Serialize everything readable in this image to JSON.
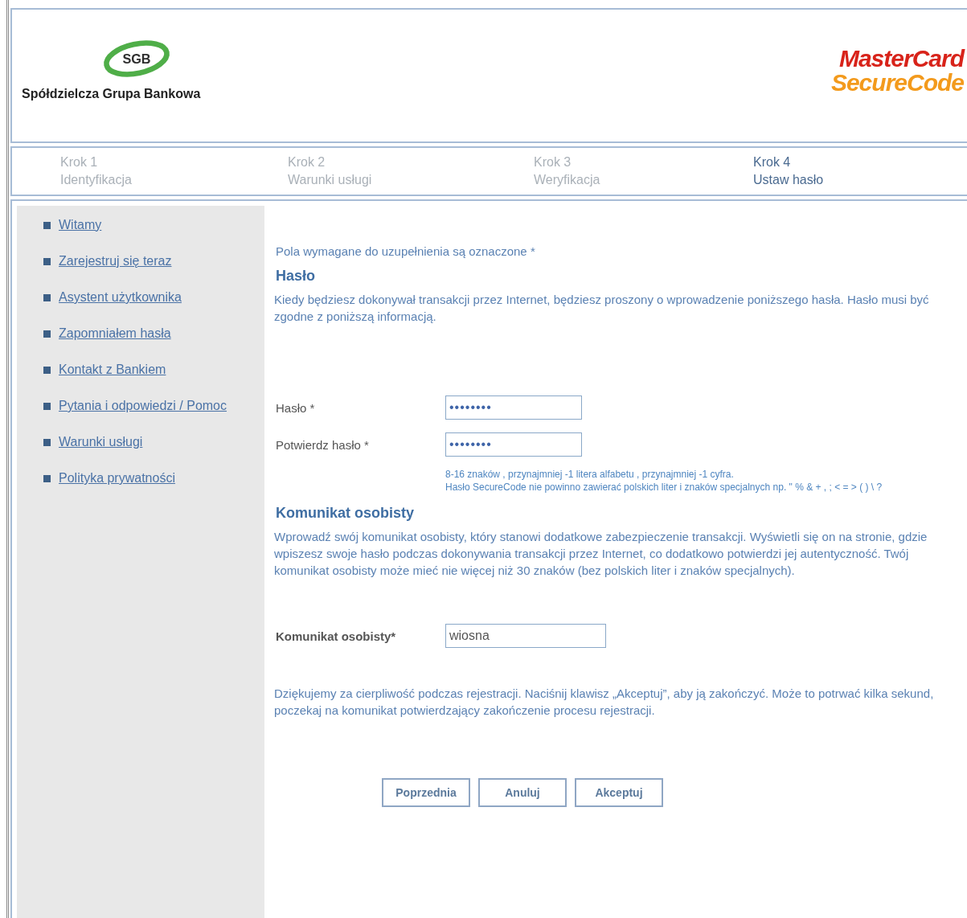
{
  "header": {
    "bank_logo": "SGB",
    "bank_name": "Spółdzielcza Grupa Bankowa",
    "brand_line_1": "MasterCard",
    "brand_line_2": "SecureCode"
  },
  "steps": [
    {
      "number": "Krok 1",
      "label": "Identyfikacja",
      "selected": false
    },
    {
      "number": "Krok 2",
      "label": "Warunki usługi",
      "selected": false
    },
    {
      "number": "Krok 3",
      "label": "Weryfikacja",
      "selected": false
    },
    {
      "number": "Krok 4",
      "label": "Ustaw hasło",
      "selected": true
    }
  ],
  "sidebar": {
    "items": [
      "Witamy",
      "Zarejestruj się teraz",
      "Asystent użytkownika",
      "Zapomniałem hasła",
      "Kontakt z Bankiem",
      "Pytania i odpowiedzi / Pomoc",
      "Warunki usługi",
      "Polityka prywatności"
    ]
  },
  "required_note": "Pola wymagane do uzupełnienia są oznaczone *",
  "password_section": {
    "title": "Hasło",
    "description": "Kiedy będziesz dokonywał transakcji przez Internet, będziesz proszony o wprowadzenie poniższego hasła. Hasło musi być zgodne z poniższą informacją.",
    "fields": [
      {
        "label": "Hasło *",
        "value": "••••••••"
      },
      {
        "label": "Potwierdz hasło *",
        "value": "••••••••"
      }
    ],
    "hints": [
      "8-16 znaków , przynajmniej -1 litera alfabetu , przynajmniej -1 cyfra.",
      "Hasło SecureCode nie powinno zawierać polskich liter i znaków specjalnych np. \" % & + , ; < = > ( ) \\ ?"
    ]
  },
  "message_section": {
    "title": "Komunikat osobisty",
    "description": "Wprowadź swój komunikat osobisty, który stanowi dodatkowe zabezpieczenie transakcji. Wyświetli się on na stronie, gdzie wpiszesz swoje hasło podczas dokonywania transakcji przez Internet, co dodatkowo potwierdzi jej autentyczność. Twój komunikat osobisty może mieć nie więcej niż 30 znaków (bez polskich liter i znaków specjalnych).",
    "field": {
      "label": "Komunikat osobisty*",
      "value": "wiosna"
    }
  },
  "closing_note": "Dziękujemy za cierpliwość podczas rejestracji. Naciśnij klawisz „Akceptuj”, aby ją zakończyć. Może to potrwać kilka sekund, poczekaj na komunikat potwierdzający zakończenie procesu rejestracji.",
  "buttons": [
    "Poprzednia",
    "Anuluj",
    "Akceptuj"
  ]
}
